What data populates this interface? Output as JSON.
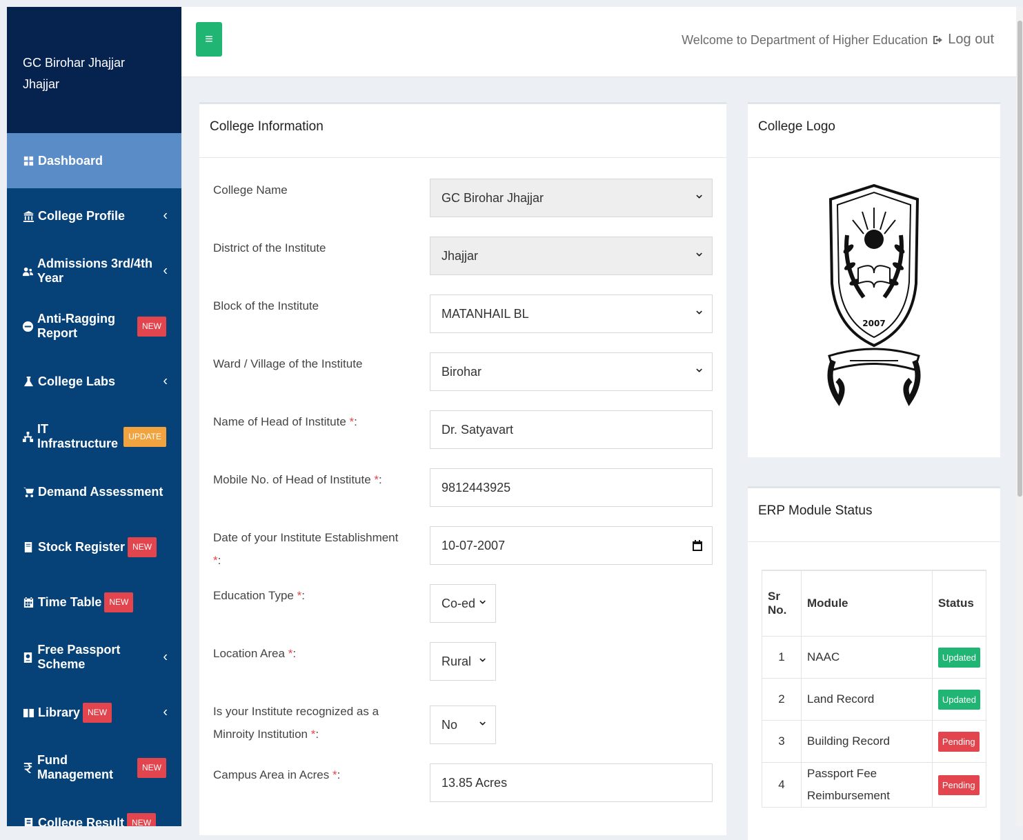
{
  "sidebar": {
    "college_name": "GC Birohar Jhajjar",
    "college_city": "Jhajjar",
    "items": [
      {
        "label": "Dashboard",
        "icon": "dashboard-icon",
        "badge": null
      },
      {
        "label": "College Profile",
        "icon": "bank-icon",
        "badge": null
      },
      {
        "label": "Admissions 3rd/4th Year",
        "icon": "users-icon",
        "badge": null
      },
      {
        "label": "Anti-Ragging Report",
        "icon": "minus-circle-icon",
        "badge": "NEW"
      },
      {
        "label": "College Labs",
        "icon": "flask-icon",
        "badge": null
      },
      {
        "label": "IT Infrastructure",
        "icon": "sitemap-icon",
        "badge": "UPDATE"
      },
      {
        "label": "Demand Assessment",
        "icon": "cart-icon",
        "badge": null
      },
      {
        "label": "Stock Register",
        "icon": "book-icon",
        "badge": "NEW"
      },
      {
        "label": "Time Table",
        "icon": "calendar-icon",
        "badge": "NEW"
      },
      {
        "label": "Free Passport Scheme",
        "icon": "passport-icon",
        "badge": null
      },
      {
        "label": "Library",
        "icon": "library-icon",
        "badge": "NEW"
      },
      {
        "label": "Fund Management",
        "icon": "rupee-icon",
        "badge": "NEW"
      },
      {
        "label": "College Result",
        "icon": "result-icon",
        "badge": "NEW"
      }
    ]
  },
  "topbar": {
    "menu_toggle": "≡",
    "welcome": "Welcome to Department of Higher Education",
    "logout": "Log out"
  },
  "college_info": {
    "title": "College Information",
    "fields": [
      {
        "label": "College Name",
        "value": "GC Birohar Jhajjar",
        "required": false
      },
      {
        "label": "District of the Institute",
        "value": "Jhajjar",
        "required": false
      },
      {
        "label": "Block of the Institute",
        "value": "MATANHAIL BL",
        "required": false
      },
      {
        "label": "Ward / Village of the Institute",
        "value": "Birohar",
        "required": false
      },
      {
        "label": "Name of Head of Institute",
        "value": "Dr. Satyavart",
        "required": true
      },
      {
        "label": "Mobile No. of Head of Institute",
        "value": "9812443925",
        "required": true
      },
      {
        "label": "Date of your Institute Establishment",
        "value": "10-07-2007",
        "required": true
      },
      {
        "label": "Education Type",
        "value": "Co-ed",
        "required": true
      },
      {
        "label": "Location Area",
        "value": "Rural",
        "required": true
      },
      {
        "label": "Is your Institute recognized as a Minroity Institution",
        "value": "No",
        "required": true
      },
      {
        "label": "Campus Area in Acres",
        "value": "13.85 Acres",
        "required": true
      }
    ],
    "required_marker": "*",
    "label_suffix": ":"
  },
  "college_logo": {
    "title": "College Logo",
    "emblem_year": "2007"
  },
  "erp_status": {
    "title": "ERP Module Status",
    "headers": [
      "Sr No.",
      "Module",
      "Status"
    ],
    "rows": [
      {
        "sr": "1",
        "module": "NAAC",
        "status": "Updated"
      },
      {
        "sr": "2",
        "module": "Land Record",
        "status": "Updated"
      },
      {
        "sr": "3",
        "module": "Building Record",
        "status": "Pending"
      },
      {
        "sr": "4",
        "module": "Passport Fee Reimbursement",
        "status": "Pending"
      }
    ]
  },
  "colors": {
    "sidebar_bg": "#064178",
    "sidebar_header_bg": "#06224e",
    "active_item_bg": "#5a8cc8",
    "accent_green": "#21b573",
    "badge_red": "#e2454d",
    "badge_orange": "#f0a33f"
  }
}
